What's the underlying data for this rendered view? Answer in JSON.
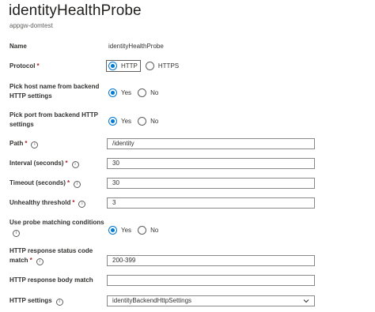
{
  "header": {
    "title": "identityHealthProbe",
    "subtitle": "appgw-domtest"
  },
  "form": {
    "name": {
      "label": "Name",
      "value": "identityHealthProbe"
    },
    "protocol": {
      "label": "Protocol",
      "required": "*",
      "options": [
        "HTTP",
        "HTTPS"
      ],
      "selected": "HTTP"
    },
    "pick_host": {
      "label_line1": "Pick host name from backend",
      "label_line2": "HTTP settings",
      "options": [
        "Yes",
        "No"
      ],
      "selected": "Yes"
    },
    "pick_port": {
      "label_line1": "Pick port from backend HTTP",
      "label_line2": "settings",
      "options": [
        "Yes",
        "No"
      ],
      "selected": "Yes"
    },
    "path": {
      "label": "Path",
      "required": "*",
      "value": "/identity"
    },
    "interval": {
      "label": "Interval (seconds)",
      "required": "*",
      "value": "30"
    },
    "timeout": {
      "label": "Timeout (seconds)",
      "required": "*",
      "value": "30"
    },
    "unhealthy": {
      "label": "Unhealthy threshold",
      "required": "*",
      "value": "3"
    },
    "matching": {
      "label": "Use probe matching conditions",
      "options": [
        "Yes",
        "No"
      ],
      "selected": "Yes"
    },
    "status_code": {
      "label_line1": "HTTP response status code",
      "label_line2": "match",
      "required": "*",
      "value": "200-399"
    },
    "body_match": {
      "label": "HTTP response body match",
      "value": ""
    },
    "http_settings": {
      "label": "HTTP settings",
      "value": "identityBackendHttpSettings"
    }
  },
  "icons": {
    "info": "info-icon",
    "dropdown": "chevron-down-icon"
  },
  "colors": {
    "accent": "#0078d4",
    "required": "#a4262c",
    "border": "#8a8886"
  }
}
